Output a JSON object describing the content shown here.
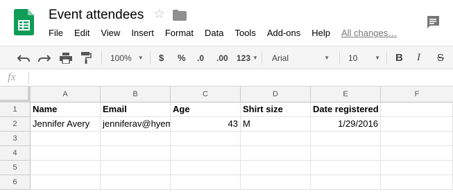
{
  "document": {
    "title": "Event attendees"
  },
  "menu": {
    "items": [
      "File",
      "Edit",
      "View",
      "Insert",
      "Format",
      "Data",
      "Tools",
      "Add-ons",
      "Help"
    ],
    "changes_link": "All changes…"
  },
  "toolbar": {
    "zoom": "100%",
    "currency": "$",
    "percent": "%",
    "decrease_decimals": ".0",
    "increase_decimals": ".00",
    "number_format": "123",
    "font": "Arial",
    "font_size": "10",
    "bold": "B",
    "italic": "I",
    "strikethrough": "S"
  },
  "formula_bar": {
    "label": "fx",
    "value": ""
  },
  "sheet": {
    "columns": [
      "A",
      "B",
      "C",
      "D",
      "E",
      "F"
    ],
    "rows": [
      "1",
      "2",
      "3",
      "4",
      "5",
      "6"
    ],
    "cells": {
      "r1": [
        "Name",
        "Email",
        "Age",
        "Shirt size",
        "Date registered",
        ""
      ],
      "r2": [
        "Jennifer Avery",
        "jenniferav@hyem",
        "43",
        "M",
        "1/29/2016",
        ""
      ]
    }
  },
  "colors": {
    "logo_green": "#0f9d58",
    "header_gray": "#f3f3f3",
    "grid_line": "#e2e2e2"
  },
  "icons": [
    "spreadsheet-logo-icon",
    "star-icon",
    "folder-icon",
    "comment-icon",
    "undo-icon",
    "redo-icon",
    "print-icon",
    "paint-format-icon"
  ]
}
